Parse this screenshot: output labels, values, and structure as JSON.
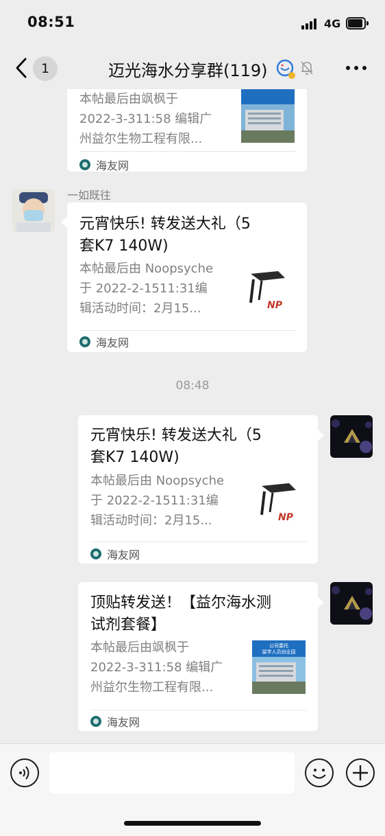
{
  "status_bar": {
    "time": "08:51",
    "network": "4G",
    "icons": [
      "signal-bars-icon",
      "battery-icon"
    ]
  },
  "nav": {
    "back_icon": "chevron-left-icon",
    "unread_count": "1",
    "title": "迈光海水分享群(119)",
    "icons": [
      "chat-bubble-emoji-icon",
      "mute-bell-icon",
      "more-dots-icon"
    ]
  },
  "chat": {
    "top_partial_card": {
      "desc": "本帖最后由飒枫于 2022-3-311:58 编辑广州益尔生物工程有限...",
      "desc_lines": [
        "本帖最后由飒枫于",
        "2022-3-311:58 编辑广",
        "州益尔生物工程有限..."
      ],
      "source": "海友网",
      "thumb": "building-photo"
    },
    "sender_name": "一如既往",
    "left_card": {
      "title_lines": [
        "元宵快乐! 转发送大礼（5",
        "套K7  140W)"
      ],
      "desc_lines": [
        "本帖最后由 Noopsyche",
        "于 2022-2-1511:31编",
        "辑活动时间：2月15..."
      ],
      "source": "海友网",
      "thumb": "aquarium-light-photo",
      "thumb_text": "NP"
    },
    "timestamp": "08:48",
    "right_card_1": {
      "title_lines": [
        "元宵快乐! 转发送大礼（5",
        "套K7  140W)"
      ],
      "desc_lines": [
        "本帖最后由 Noopsyche",
        "于 2022-2-1511:31编",
        "辑活动时间：2月15..."
      ],
      "source": "海友网",
      "thumb": "aquarium-light-photo",
      "thumb_text": "NP"
    },
    "right_card_2": {
      "title_lines": [
        "顶贴转发送！【益尔海水测",
        "试剂套餐】"
      ],
      "desc_lines": [
        "本帖最后由飒枫于",
        "2022-3-311:58 编辑广",
        "州益尔生物工程有限..."
      ],
      "source": "海友网",
      "thumb": "building-photo",
      "thumb_banner_lines": [
        "公司委托",
        "留学人员创业园"
      ]
    }
  },
  "input_bar": {
    "voice_icon": "voice-wave-icon",
    "input_value": "",
    "emoji_icon": "smiley-icon",
    "plus_icon": "plus-icon"
  },
  "colors": {
    "background": "#ededed",
    "bubble": "#ffffff",
    "muted_text": "#808080"
  }
}
